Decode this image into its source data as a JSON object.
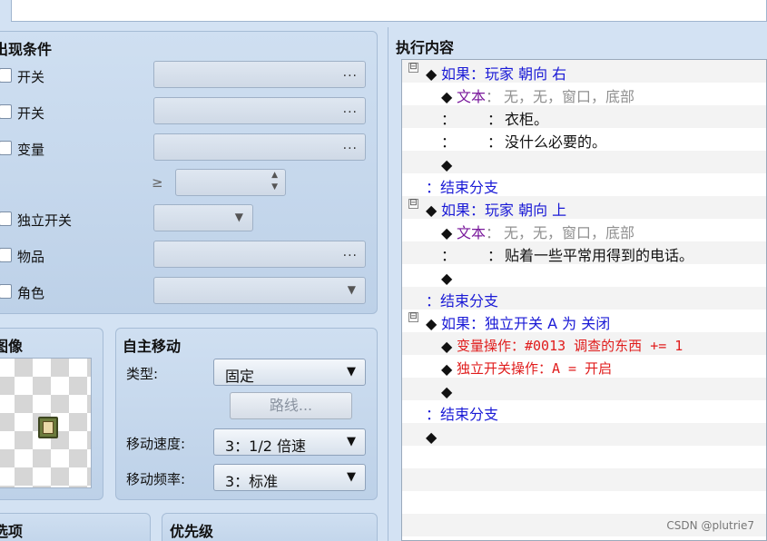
{
  "conditions": {
    "title": "出现条件",
    "switch1_label": "开关",
    "switch2_label": "开关",
    "variable_label": "变量",
    "ge_symbol": "≥",
    "self_switch_label": "独立开关",
    "item_label": "物品",
    "actor_label": "角色",
    "dots": "..."
  },
  "image": {
    "title": "图像"
  },
  "autonomous": {
    "title": "自主移动",
    "type_label": "类型:",
    "type_value": "固定",
    "route_button": "路线...",
    "speed_label": "移动速度:",
    "speed_value": "3：1/2 倍速",
    "freq_label": "移动频率:",
    "freq_value": "3：标准"
  },
  "options": {
    "title": "选项"
  },
  "priority": {
    "title": "优先级"
  },
  "contents": {
    "title": "执行内容",
    "rows": [
      {
        "diamond": "◆",
        "cmd": "如果：玩家 朝向 右"
      },
      {
        "diamond": "◆",
        "cmd": "文本",
        "colon": "：",
        "args": "无，无，窗口，底部"
      },
      {
        "prefix": "：",
        "colon": "：",
        "text": "衣柜。"
      },
      {
        "prefix": "：",
        "colon": "：",
        "text": "没什么必要的。"
      },
      {
        "diamond": "◆"
      },
      {
        "cmd": "：结束分支"
      },
      {
        "diamond": "◆",
        "cmd": "如果：玩家 朝向 上"
      },
      {
        "diamond": "◆",
        "cmd": "文本",
        "colon": "：",
        "args": "无，无，窗口，底部"
      },
      {
        "prefix": "：",
        "colon": "：",
        "text": "贴着一些平常用得到的电话。"
      },
      {
        "diamond": "◆"
      },
      {
        "cmd": "：结束分支"
      },
      {
        "diamond": "◆",
        "cmd": "如果：独立开关 A 为 关闭"
      },
      {
        "diamond": "◆",
        "cmd": "变量操作：#0013 调查的东西 += 1"
      },
      {
        "diamond": "◆",
        "cmd": "独立开关操作：A = 开启"
      },
      {
        "diamond": "◆"
      },
      {
        "cmd": "：结束分支"
      },
      {
        "diamond": "◆"
      }
    ],
    "expander_symbol": "⊟"
  },
  "watermark": "CSDN @plutrie7",
  "colors": {
    "branch": "#1a1ad6",
    "text_cmd": "#7a1a9c",
    "args": "#909090",
    "operation": "#e01c1c"
  }
}
